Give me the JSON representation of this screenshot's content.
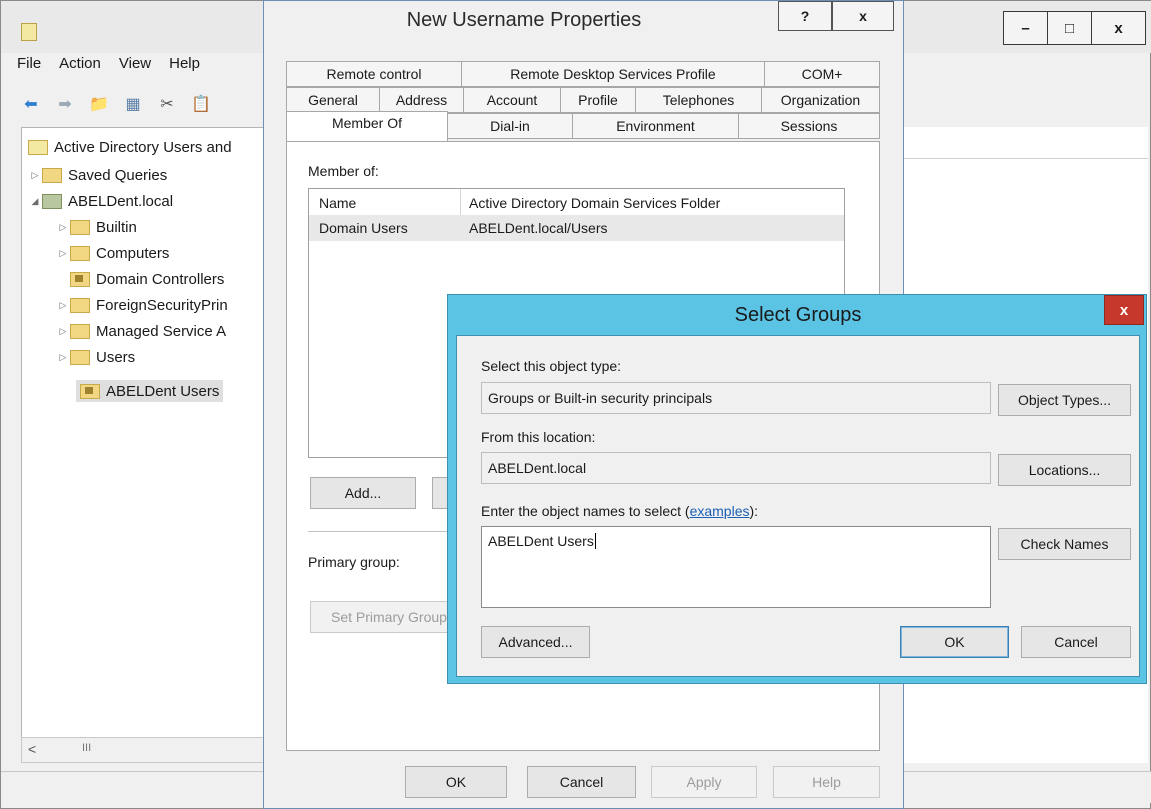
{
  "mmc": {
    "menu": [
      "File",
      "Action",
      "View",
      "Help"
    ],
    "window_buttons": {
      "minimize": "–",
      "maximize": "□",
      "close": "x"
    },
    "tree": {
      "root": "Active Directory Users and",
      "saved_queries": "Saved Queries",
      "domain": "ABELDent.local",
      "children": [
        {
          "label": "Builtin"
        },
        {
          "label": "Computers"
        },
        {
          "label": "Domain Controllers"
        },
        {
          "label": "ForeignSecurityPrin"
        },
        {
          "label": "Managed Service A"
        },
        {
          "label": "Users"
        },
        {
          "label": "ABELDent Users"
        }
      ]
    },
    "scroll_thumb": "III",
    "scroll_left": "<"
  },
  "props": {
    "title": "New Username Properties",
    "help_btn": "?",
    "close_btn": "x",
    "tabs_row1": [
      "Remote control",
      "Remote Desktop Services Profile",
      "COM+"
    ],
    "tabs_row2": [
      "General",
      "Address",
      "Account",
      "Profile",
      "Telephones",
      "Organization"
    ],
    "tabs_row3": [
      "Member Of",
      "Dial-in",
      "Environment",
      "Sessions"
    ],
    "member_of_label": "Member of:",
    "columns": [
      "Name",
      "Active Directory Domain Services Folder"
    ],
    "rows": [
      {
        "name": "Domain Users",
        "folder": "ABELDent.local/Users"
      }
    ],
    "add_button": "Add...",
    "primary_group_label": "Primary group:",
    "set_primary_button": "Set Primary Group",
    "ok": "OK",
    "cancel": "Cancel",
    "apply": "Apply",
    "help": "Help"
  },
  "select_groups": {
    "title": "Select Groups",
    "close": "x",
    "object_type_label": "Select this object type:",
    "object_type_value": "Groups or Built-in security principals",
    "object_types_button": "Object Types...",
    "location_label": "From this location:",
    "location_value": "ABELDent.local",
    "locations_button": "Locations...",
    "names_label_prefix": "Enter the object names to select (",
    "names_label_link": "examples",
    "names_label_suffix": "):",
    "names_value": "ABELDent Users",
    "check_names_button": "Check Names",
    "advanced_button": "Advanced...",
    "ok": "OK",
    "cancel": "Cancel"
  }
}
